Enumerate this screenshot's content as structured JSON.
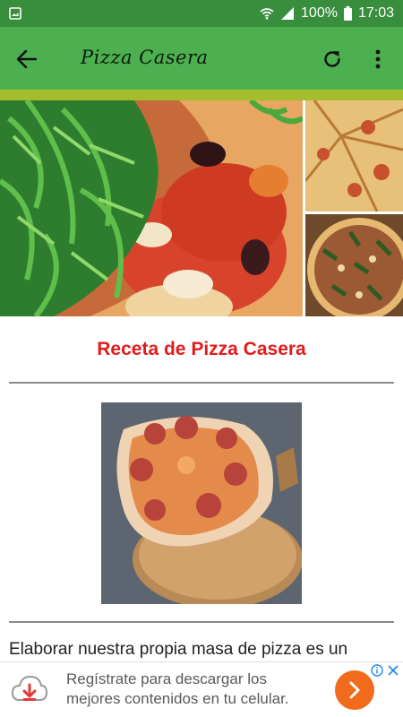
{
  "status_bar": {
    "battery": "100%",
    "time": "17:03"
  },
  "app_bar": {
    "title": "Pizza Casera"
  },
  "content": {
    "recipe_title": "Receta de Pizza Casera",
    "intro_text": "Elaborar nuestra propia masa de pizza es un"
  },
  "ad": {
    "line1": "Regístrate para descargar los",
    "line2": "mejores contenidos en tu celular."
  },
  "colors": {
    "status_bar": "#388e3c",
    "app_bar": "#4caf50",
    "accent_strip": "#a4bd2c",
    "title_red": "#e21b1b",
    "ad_button": "#f26a1b"
  },
  "icons": {
    "status_left": "image-notification-icon",
    "wifi": "wifi-icon",
    "signal": "signal-icon",
    "battery": "battery-icon",
    "back": "arrow-back-icon",
    "refresh": "refresh-icon",
    "more": "more-vert-icon",
    "ad": "cloud-download-icon",
    "ad_cta": "chevron-right-icon",
    "ad_info": "info-icon",
    "ad_close": "close-icon"
  }
}
